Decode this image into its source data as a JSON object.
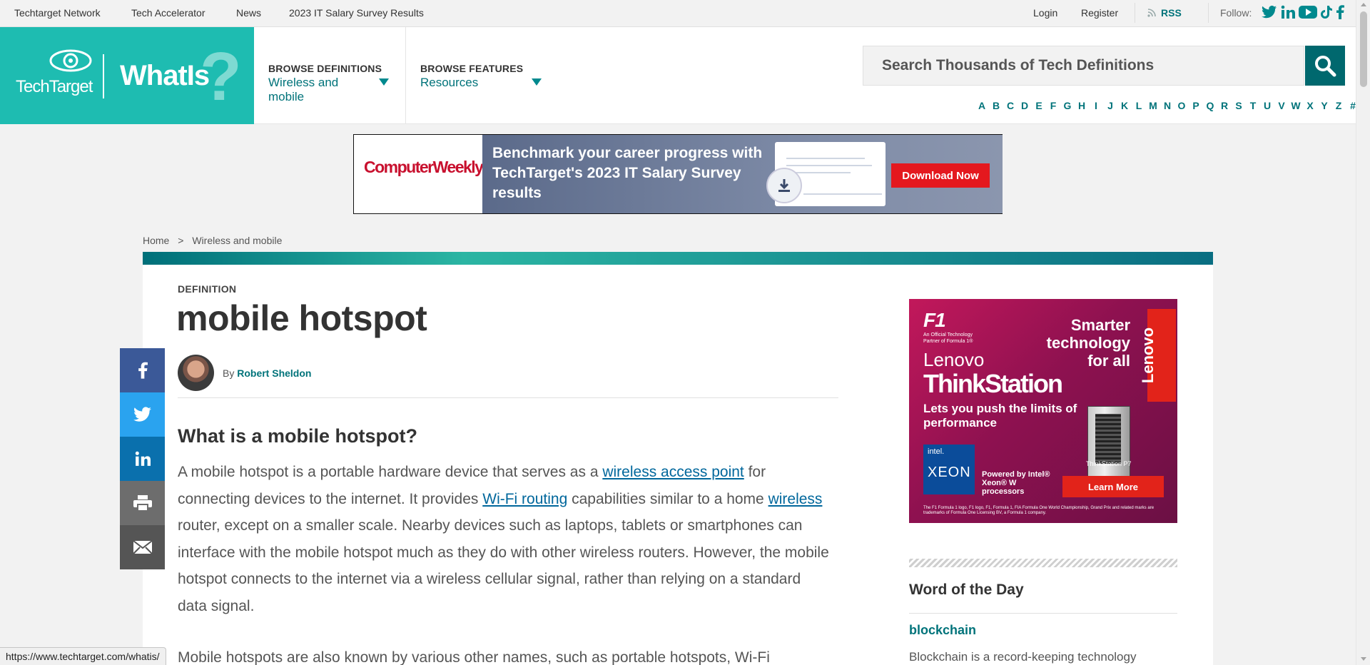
{
  "topbar": {
    "links": [
      "Techtarget Network",
      "Tech Accelerator",
      "News",
      "2023 IT Salary Survey Results"
    ],
    "login": "Login",
    "register": "Register",
    "rss": "RSS",
    "follow": "Follow:"
  },
  "header": {
    "logo_brand": "TechTarget",
    "logo_site": "WhatIs",
    "browse_definitions": {
      "heading": "BROWSE DEFINITIONS",
      "value": "Wireless and mobile"
    },
    "browse_features": {
      "heading": "BROWSE FEATURES",
      "value": "Resources"
    },
    "search_placeholder": "Search Thousands of Tech Definitions",
    "alphabet": [
      "A",
      "B",
      "C",
      "D",
      "E",
      "F",
      "G",
      "H",
      "I",
      "J",
      "K",
      "L",
      "M",
      "N",
      "O",
      "P",
      "Q",
      "R",
      "S",
      "T",
      "U",
      "V",
      "W",
      "X",
      "Y",
      "Z",
      "#"
    ]
  },
  "ad_banner": {
    "brand": "ComputerWeekly.com",
    "text": "Benchmark your career progress with TechTarget's 2023 IT Salary Survey results",
    "button": "Download Now"
  },
  "breadcrumb": {
    "home": "Home",
    "separator": ">",
    "current": "Wireless and mobile"
  },
  "article": {
    "label": "DEFINITION",
    "title": "mobile hotspot",
    "by": "By",
    "author": "Robert Sheldon",
    "heading": "What is a mobile hotspot?",
    "p1_a": "A mobile hotspot is a portable hardware device that serves as a ",
    "p1_link1": "wireless access point",
    "p1_b": " for connecting devices to the internet. It provides ",
    "p1_link2": "Wi-Fi routing",
    "p1_c": " capabilities similar to a home ",
    "p1_link3": "wireless",
    "p1_d": " router, except on a smaller scale. Nearby devices such as laptops, tablets or smartphones can interface with the mobile hotspot much as they do with other wireless routers. However, the mobile hotspot connects to the internet via a wireless cellular signal, rather than relying on a standard data signal.",
    "p2": "Mobile hotspots are also known by various other names, such as portable hotspots, Wi-Fi"
  },
  "share_icons": [
    "facebook-icon",
    "twitter-icon",
    "linkedin-icon",
    "print-icon",
    "email-icon"
  ],
  "rail_ad": {
    "f1": "F1",
    "f1_sub": "An Official Technology Partner of Formula 1®",
    "headline": "Smarter technology for all",
    "brand_vertical": "Lenovo",
    "lenovo": "Lenovo",
    "product": "ThinkStation",
    "tagline": "Lets you push the limits of performance",
    "intel": "intel.",
    "xeon": "XEON",
    "powered": "Powered by Intel® Xeon® W processors",
    "model": "ThinkStation P7",
    "button": "Learn More",
    "fine_print": "The F1 Formula 1 logo, F1 logo, F1, Formula 1, FIA Formula One World Championship, Grand Prix and related marks are trademarks of Formula One Licensing BV, a Formula 1 company."
  },
  "word_of_day": {
    "title": "Word of the Day",
    "word": "blockchain",
    "desc": "Blockchain is a record-keeping technology"
  },
  "statusbar": {
    "url": "https://www.techtarget.com/whatis/"
  },
  "colors": {
    "brand_teal": "#1ebcb1",
    "link_teal": "#00737a",
    "search_button": "#00686e"
  }
}
